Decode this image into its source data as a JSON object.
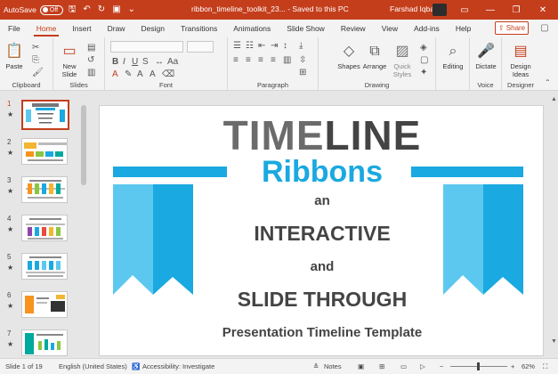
{
  "titlebar": {
    "autosave_label": "AutoSave",
    "autosave_state": "Off",
    "document_title": "ribbon_timeline_toolkit_23... - Saved to this PC",
    "user_name": "Farshad Iqbal",
    "minimize_icon": "—",
    "restore_icon": "❐",
    "close_icon": "✕",
    "accent_color": "#c43e1c"
  },
  "tabs": [
    "File",
    "Home",
    "Insert",
    "Draw",
    "Design",
    "Transitions",
    "Animations",
    "Slide Show",
    "Review",
    "View",
    "Add-ins",
    "Help"
  ],
  "active_tab": "Home",
  "share_label": "Share",
  "ribbon": {
    "clipboard": {
      "paste_label": "Paste",
      "group_label": "Clipboard"
    },
    "slides": {
      "new_slide_label": "New Slide",
      "group_label": "Slides"
    },
    "font": {
      "group_label": "Font"
    },
    "paragraph": {
      "group_label": "Paragraph"
    },
    "drawing": {
      "shapes_label": "Shapes",
      "arrange_label": "Arrange",
      "quick_styles_label": "Quick Styles",
      "group_label": "Drawing"
    },
    "editing": {
      "editing_label": "Editing"
    },
    "voice": {
      "dictate_label": "Dictate",
      "group_label": "Voice"
    },
    "designer": {
      "design_ideas_label": "Design Ideas",
      "group_label": "Designer"
    }
  },
  "thumbnails": [
    {
      "number": "1"
    },
    {
      "number": "2"
    },
    {
      "number": "3"
    },
    {
      "number": "4"
    },
    {
      "number": "5"
    },
    {
      "number": "6"
    },
    {
      "number": "7"
    }
  ],
  "slide": {
    "title_part1": "TIME",
    "title_part2": "LINE",
    "subtitle": "Ribbons",
    "line1": "an",
    "line2": "INTERACTIVE",
    "line3": "and",
    "line4": "SLIDE THROUGH",
    "line5": "Presentation Timeline Template",
    "ribbon_color_dark": "#1aa9e0",
    "ribbon_color_light": "#5cc8f0"
  },
  "statusbar": {
    "slide_count": "Slide 1 of 19",
    "language": "English (United States)",
    "accessibility": "Accessibility: Investigate",
    "notes_label": "Notes",
    "zoom": "62%"
  }
}
